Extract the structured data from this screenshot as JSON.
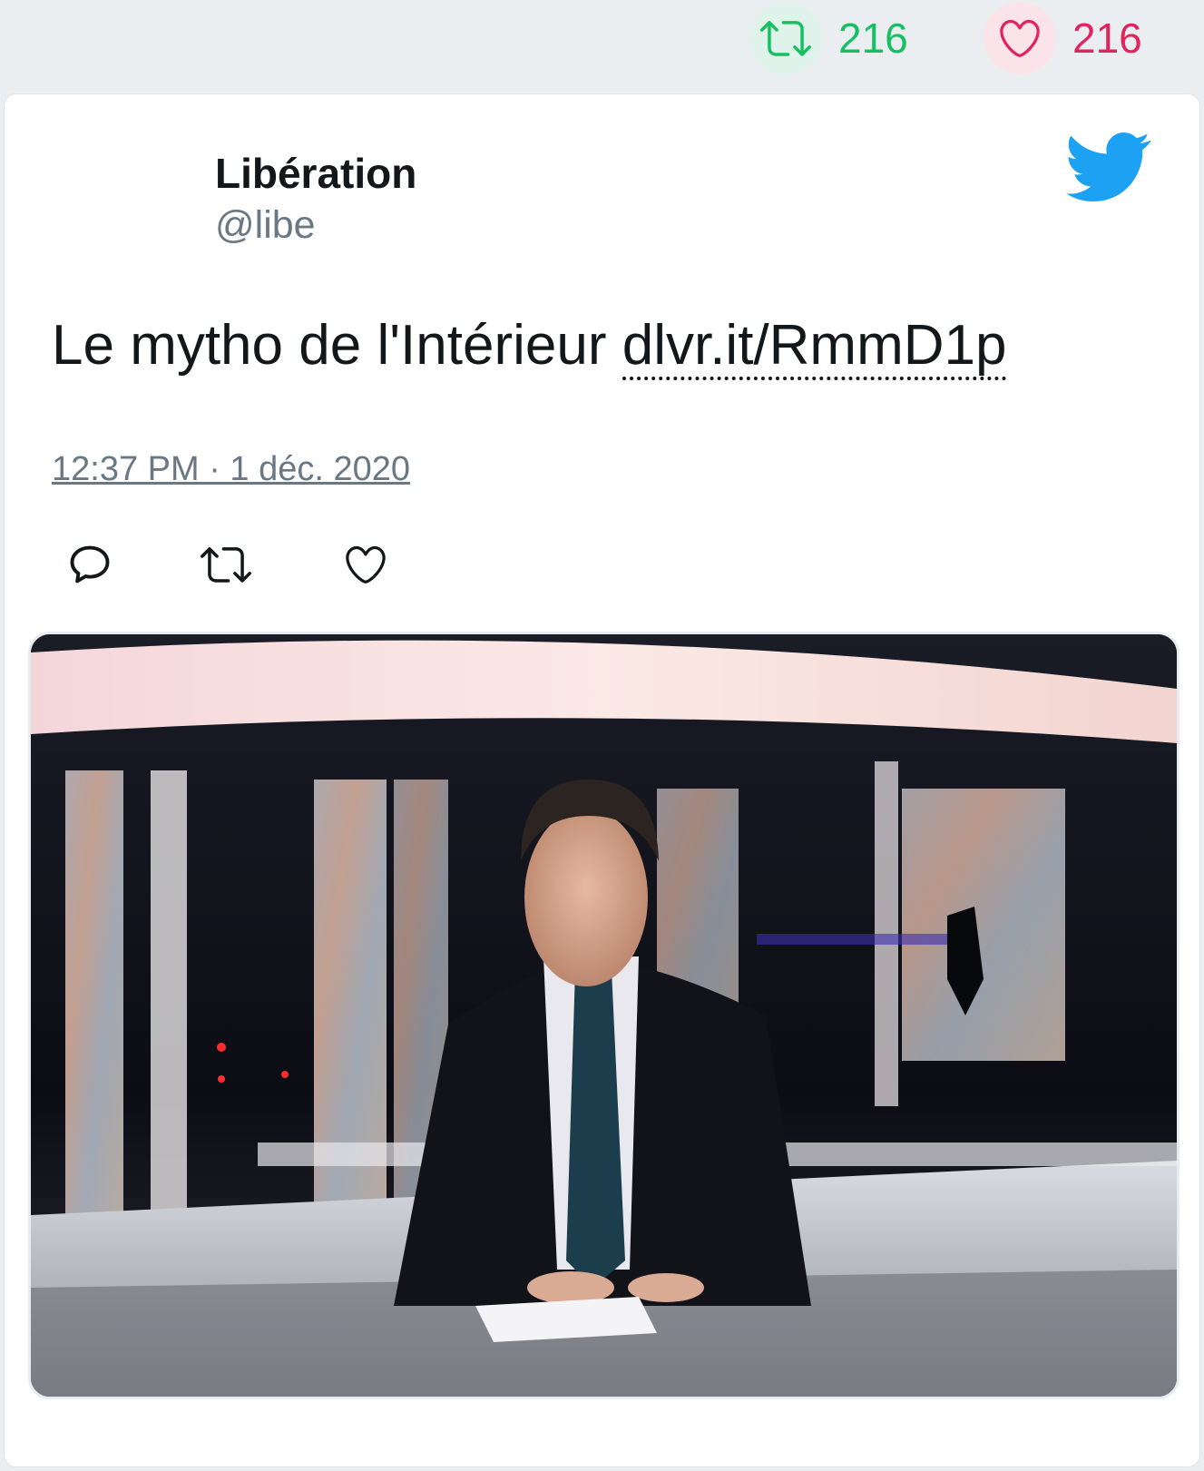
{
  "stats": {
    "retweets": {
      "count": "216",
      "icon": "retweet-icon",
      "color": "#17bf63"
    },
    "likes": {
      "count": "216",
      "icon": "heart-icon",
      "color": "#e0245e"
    }
  },
  "tweet": {
    "author": {
      "name": "Libération",
      "handle": "@libe"
    },
    "logo": "twitter-bird-icon",
    "text": "Le mytho de l'Intérieur ",
    "link": "dlvr.it/RmmD1p",
    "timestamp": "12:37 PM · 1 déc. 2020",
    "actions": {
      "reply_icon": "reply-icon",
      "retweet_icon": "retweet-icon",
      "like_icon": "heart-icon"
    },
    "media": {
      "type": "photo"
    }
  },
  "colors": {
    "background": "#ebeef0",
    "twitter_blue": "#1da1f2",
    "text": "#14171a",
    "muted": "#697882"
  }
}
